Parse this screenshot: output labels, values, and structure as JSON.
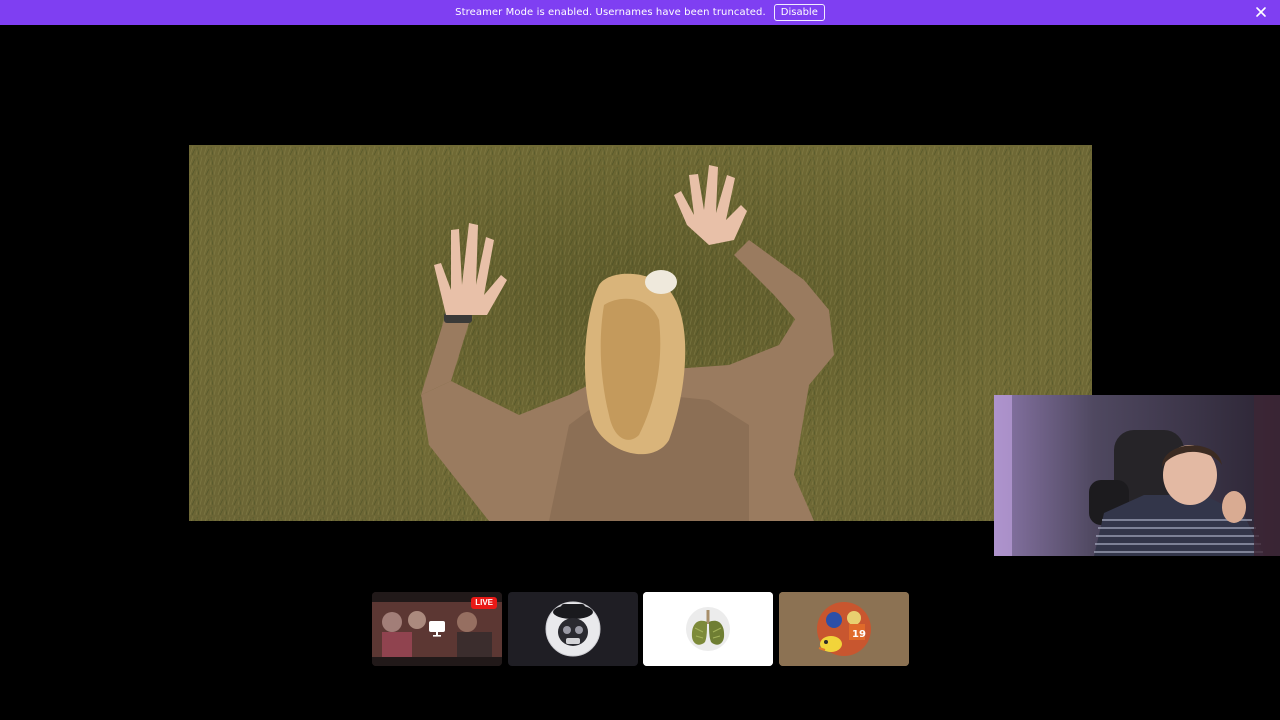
{
  "banner": {
    "message": "Streamer Mode is enabled. Usernames have been truncated.",
    "button_label": "Disable",
    "close_icon": "close-icon",
    "color": "#7f3ff2"
  },
  "thumbnails": [
    {
      "kind": "screenshare",
      "badge": "LIVE",
      "icon": "screen-share-icon"
    },
    {
      "kind": "avatar",
      "icon": "masked-figure-avatar"
    },
    {
      "kind": "avatar",
      "icon": "lungs-avatar"
    },
    {
      "kind": "avatar",
      "icon": "collage-avatar"
    }
  ],
  "colors": {
    "background": "#000000",
    "live_badge": "#e91916"
  }
}
